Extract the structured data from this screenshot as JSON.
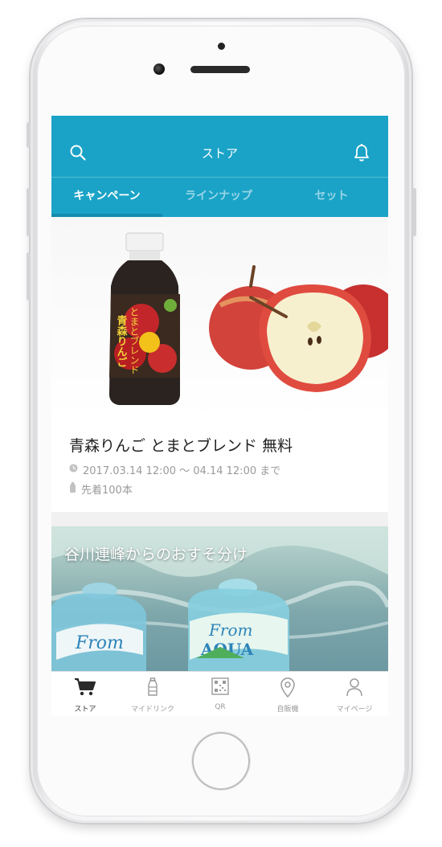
{
  "header": {
    "title": "ストア",
    "search_icon": "search-icon",
    "bell_icon": "bell-icon"
  },
  "tabs": [
    {
      "label": "キャンペーン",
      "active": true
    },
    {
      "label": "ラインナップ",
      "active": false
    },
    {
      "label": "セット",
      "active": false
    }
  ],
  "campaigns": [
    {
      "title": "青森りんご とまとブレンド 無料",
      "period": "2017.03.14 12:00 〜 04.14 12:00 まで",
      "limit": "先着100本",
      "product_label": "青森りんご とまとブレンド"
    },
    {
      "title": "谷川連峰からのおすそ分け",
      "product_label": "From AQUA"
    }
  ],
  "bottom_nav": [
    {
      "label": "ストア",
      "icon": "cart-icon",
      "active": true
    },
    {
      "label": "マイドリンク",
      "icon": "bottle-icon",
      "active": false
    },
    {
      "label": "QR",
      "icon": "qr-icon",
      "active": false
    },
    {
      "label": "自販機",
      "icon": "map-pin-icon",
      "active": false
    },
    {
      "label": "マイページ",
      "icon": "person-icon",
      "active": false
    }
  ],
  "colors": {
    "accent": "#1aa3c7",
    "tab_indicator": "#138cae",
    "text_primary": "#222222",
    "text_secondary": "#9a9a9a"
  }
}
